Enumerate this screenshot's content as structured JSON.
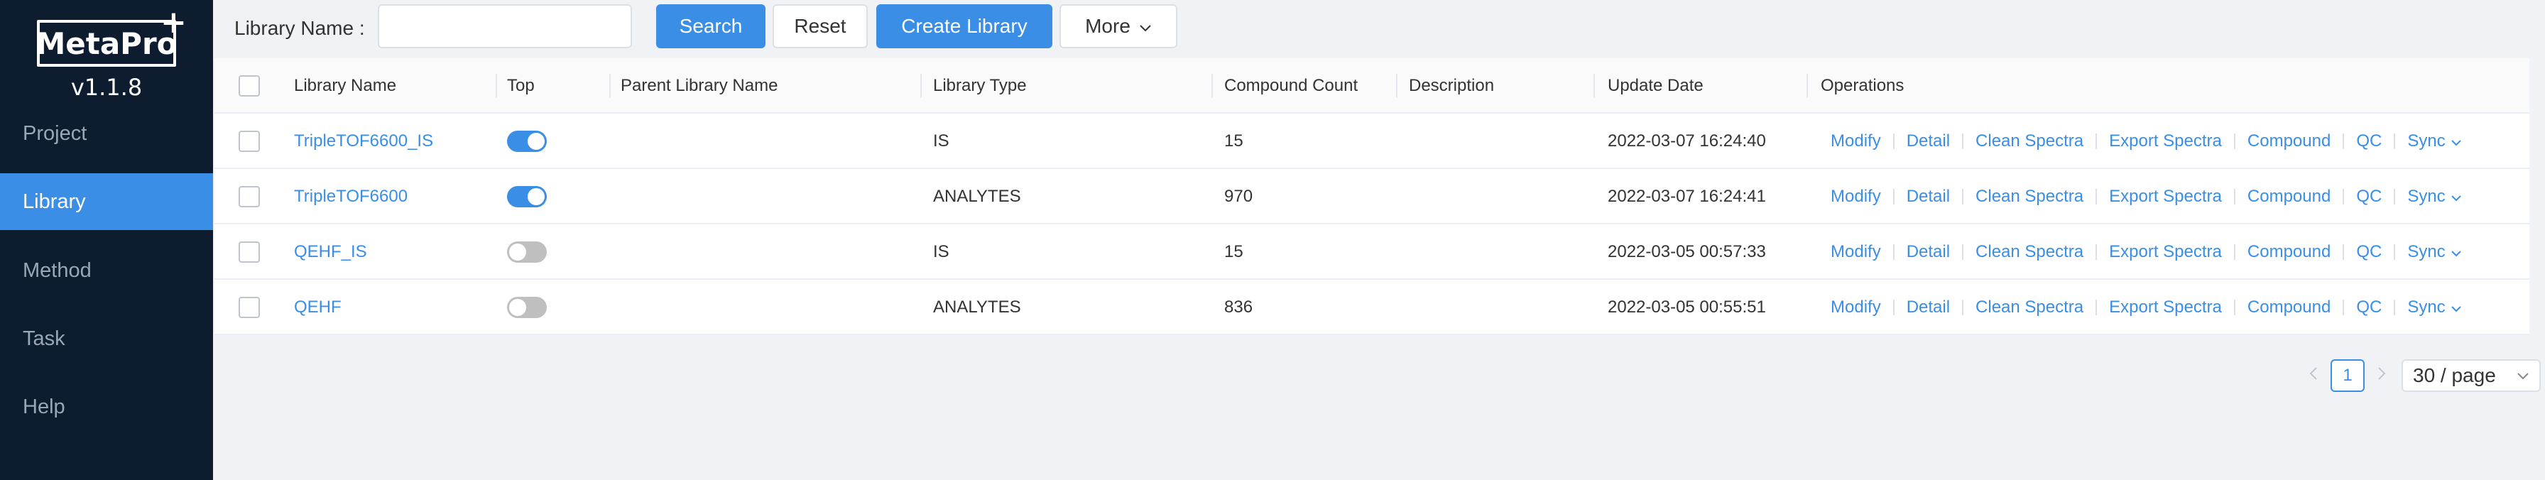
{
  "app": {
    "logo_text": "MetaPro",
    "logo_plus": "+",
    "version": "v1.1.8"
  },
  "sidebar": {
    "items": [
      {
        "label": "Project",
        "active": false
      },
      {
        "label": "Library",
        "active": true
      },
      {
        "label": "Method",
        "active": false
      },
      {
        "label": "Task",
        "active": false
      },
      {
        "label": "Help",
        "active": false
      }
    ]
  },
  "toolbar": {
    "library_name_label": "Library Name :",
    "library_name_value": "",
    "library_name_placeholder": "",
    "search_label": "Search",
    "reset_label": "Reset",
    "create_label": "Create Library",
    "more_label": "More",
    "more_icon": "chevron-down-icon"
  },
  "table": {
    "headers": {
      "library_name": "Library Name",
      "top": "Top",
      "parent_library_name": "Parent Library Name",
      "library_type": "Library Type",
      "compound_count": "Compound Count",
      "description": "Description",
      "update_date": "Update Date",
      "operations": "Operations"
    },
    "rows": [
      {
        "library_name": "TripleTOF6600_IS",
        "top": true,
        "parent_library_name": "",
        "library_type": "IS",
        "compound_count": "15",
        "description": "",
        "update_date": "2022-03-07 16:24:40"
      },
      {
        "library_name": "TripleTOF6600",
        "top": true,
        "parent_library_name": "",
        "library_type": "ANALYTES",
        "compound_count": "970",
        "description": "",
        "update_date": "2022-03-07 16:24:41"
      },
      {
        "library_name": "QEHF_IS",
        "top": false,
        "parent_library_name": "",
        "library_type": "IS",
        "compound_count": "15",
        "description": "",
        "update_date": "2022-03-05 00:57:33"
      },
      {
        "library_name": "QEHF",
        "top": false,
        "parent_library_name": "",
        "library_type": "ANALYTES",
        "compound_count": "836",
        "description": "",
        "update_date": "2022-03-05 00:55:51"
      }
    ],
    "operations": [
      "Modify",
      "Detail",
      "Clean Spectra",
      "Export Spectra",
      "Compound",
      "QC",
      "Sync"
    ]
  },
  "pagination": {
    "current_page": "1",
    "page_size": "30 / page"
  },
  "colors": {
    "accent": "#3a8ee6",
    "sidebar_bg": "#0d1c2e",
    "page_bg": "#f0f2f5"
  }
}
